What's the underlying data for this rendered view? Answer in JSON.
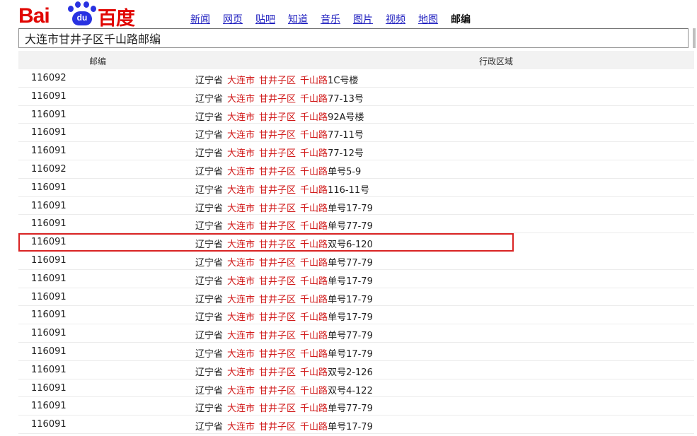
{
  "logo": {
    "text_latin": "Bai",
    "text_du": "du",
    "text_cn": "百度"
  },
  "nav": [
    {
      "label": "新闻",
      "active": false
    },
    {
      "label": "网页",
      "active": false
    },
    {
      "label": "贴吧",
      "active": false
    },
    {
      "label": "知道",
      "active": false
    },
    {
      "label": "音乐",
      "active": false
    },
    {
      "label": "图片",
      "active": false
    },
    {
      "label": "视频",
      "active": false
    },
    {
      "label": "地图",
      "active": false
    },
    {
      "label": "邮编",
      "active": true
    }
  ],
  "search": {
    "value": "大连市甘井子区千山路邮编"
  },
  "table": {
    "headers": {
      "code": "邮编",
      "region": "行政区域"
    },
    "highlight_index": 9,
    "rows": [
      {
        "code": "116092",
        "prov": "辽宁省",
        "city": "大连市",
        "district": "甘井子区",
        "road": "千山路",
        "num": "1C号楼"
      },
      {
        "code": "116091",
        "prov": "辽宁省",
        "city": "大连市",
        "district": "甘井子区",
        "road": "千山路",
        "num": "77-13号"
      },
      {
        "code": "116091",
        "prov": "辽宁省",
        "city": "大连市",
        "district": "甘井子区",
        "road": "千山路",
        "num": "92A号楼"
      },
      {
        "code": "116091",
        "prov": "辽宁省",
        "city": "大连市",
        "district": "甘井子区",
        "road": "千山路",
        "num": "77-11号"
      },
      {
        "code": "116091",
        "prov": "辽宁省",
        "city": "大连市",
        "district": "甘井子区",
        "road": "千山路",
        "num": "77-12号"
      },
      {
        "code": "116092",
        "prov": "辽宁省",
        "city": "大连市",
        "district": "甘井子区",
        "road": "千山路",
        "num": "单号5-9"
      },
      {
        "code": "116091",
        "prov": "辽宁省",
        "city": "大连市",
        "district": "甘井子区",
        "road": "千山路",
        "num": "116-11号"
      },
      {
        "code": "116091",
        "prov": "辽宁省",
        "city": "大连市",
        "district": "甘井子区",
        "road": "千山路",
        "num": "单号17-79"
      },
      {
        "code": "116091",
        "prov": "辽宁省",
        "city": "大连市",
        "district": "甘井子区",
        "road": "千山路",
        "num": "单号77-79"
      },
      {
        "code": "116091",
        "prov": "辽宁省",
        "city": "大连市",
        "district": "甘井子区",
        "road": "千山路",
        "num": "双号6-120"
      },
      {
        "code": "116091",
        "prov": "辽宁省",
        "city": "大连市",
        "district": "甘井子区",
        "road": "千山路",
        "num": "单号77-79"
      },
      {
        "code": "116091",
        "prov": "辽宁省",
        "city": "大连市",
        "district": "甘井子区",
        "road": "千山路",
        "num": "单号17-79"
      },
      {
        "code": "116091",
        "prov": "辽宁省",
        "city": "大连市",
        "district": "甘井子区",
        "road": "千山路",
        "num": "单号17-79"
      },
      {
        "code": "116091",
        "prov": "辽宁省",
        "city": "大连市",
        "district": "甘井子区",
        "road": "千山路",
        "num": "单号17-79"
      },
      {
        "code": "116091",
        "prov": "辽宁省",
        "city": "大连市",
        "district": "甘井子区",
        "road": "千山路",
        "num": "单号77-79"
      },
      {
        "code": "116091",
        "prov": "辽宁省",
        "city": "大连市",
        "district": "甘井子区",
        "road": "千山路",
        "num": "单号17-79"
      },
      {
        "code": "116091",
        "prov": "辽宁省",
        "city": "大连市",
        "district": "甘井子区",
        "road": "千山路",
        "num": "双号2-126"
      },
      {
        "code": "116091",
        "prov": "辽宁省",
        "city": "大连市",
        "district": "甘井子区",
        "road": "千山路",
        "num": "双号4-122"
      },
      {
        "code": "116091",
        "prov": "辽宁省",
        "city": "大连市",
        "district": "甘井子区",
        "road": "千山路",
        "num": "单号77-79"
      },
      {
        "code": "116091",
        "prov": "辽宁省",
        "city": "大连市",
        "district": "甘井子区",
        "road": "千山路",
        "num": "单号17-79"
      }
    ]
  }
}
